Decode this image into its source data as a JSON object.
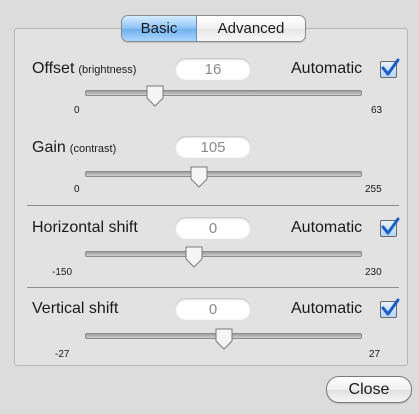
{
  "tabs": [
    {
      "label": "Basic",
      "active": true
    },
    {
      "label": "Advanced",
      "active": false
    }
  ],
  "offset": {
    "label": "Offset",
    "sublabel": "(brightness)",
    "value": "16",
    "automatic_label": "Automatic",
    "automatic_checked": true,
    "min": "0",
    "max": "63",
    "level": 16
  },
  "gain": {
    "label": "Gain",
    "sublabel": "(contrast)",
    "value": "105",
    "min": "0",
    "max": "255",
    "level": 105
  },
  "horizontal": {
    "label": "Horizontal shift",
    "value": "0",
    "automatic_label": "Automatic",
    "automatic_checked": true,
    "min": "-150",
    "max": "230",
    "level": 0
  },
  "vertical": {
    "label": "Vertical shift",
    "value": "0",
    "automatic_label": "Automatic",
    "automatic_checked": true,
    "min": "-27",
    "max": "27",
    "level": 0
  },
  "close_label": "Close",
  "colors": {
    "accent": "#6fb0ee",
    "check": "#1f5fc4"
  }
}
